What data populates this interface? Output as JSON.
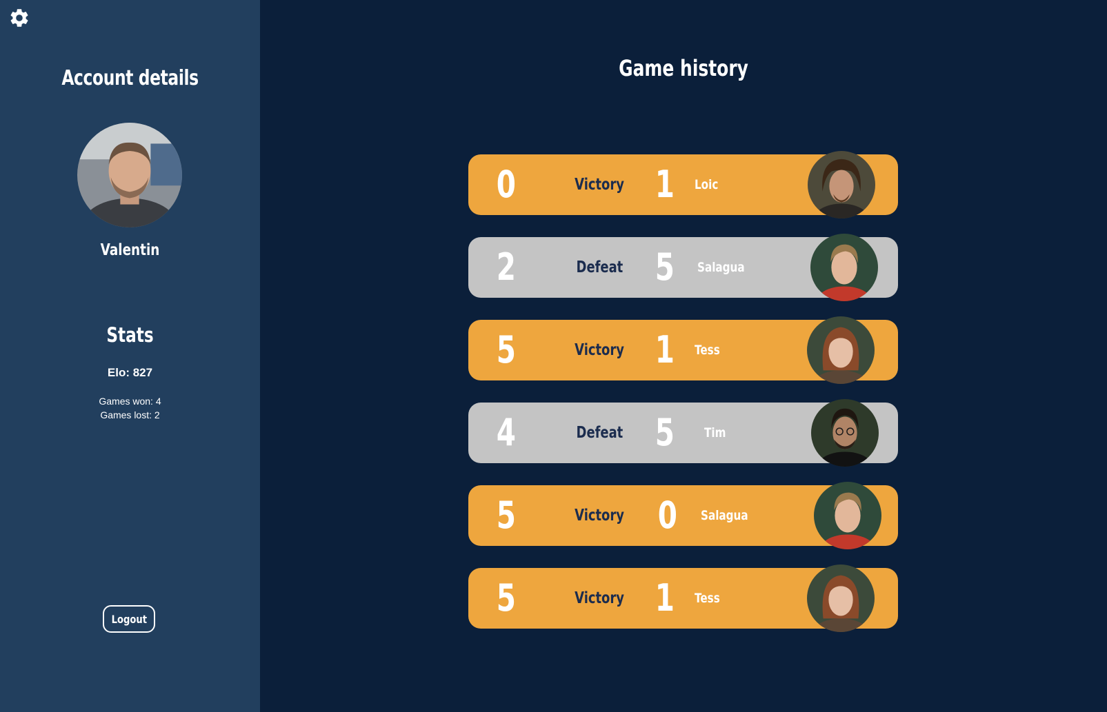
{
  "sidebar": {
    "settings_icon": "gear-icon",
    "title": "Account details",
    "username": "Valentin",
    "stats_title": "Stats",
    "elo": "Elo: 827",
    "games_won": "Games won: 4",
    "games_lost": "Games lost: 2",
    "logout_label": "Logout"
  },
  "main": {
    "title": "Game history",
    "games": [
      {
        "score_left": "0",
        "result": "Victory",
        "score_right": "1",
        "opponent": "Loic",
        "status": "win"
      },
      {
        "score_left": "2",
        "result": "Defeat",
        "score_right": "5",
        "opponent": "Salagua",
        "status": "loss"
      },
      {
        "score_left": "5",
        "result": "Victory",
        "score_right": "1",
        "opponent": "Tess",
        "status": "win"
      },
      {
        "score_left": "4",
        "result": "Defeat",
        "score_right": "5",
        "opponent": "Tim",
        "status": "loss"
      },
      {
        "score_left": "5",
        "result": "Victory",
        "score_right": "0",
        "opponent": "Salagua",
        "status": "win"
      },
      {
        "score_left": "5",
        "result": "Victory",
        "score_right": "1",
        "opponent": "Tess",
        "status": "win"
      }
    ]
  },
  "colors": {
    "background": "#0b1f3a",
    "sidebar": "#223f5e",
    "victory": "#eea63e",
    "defeat": "#c4c4c4",
    "result_text": "#1b2c4e"
  }
}
